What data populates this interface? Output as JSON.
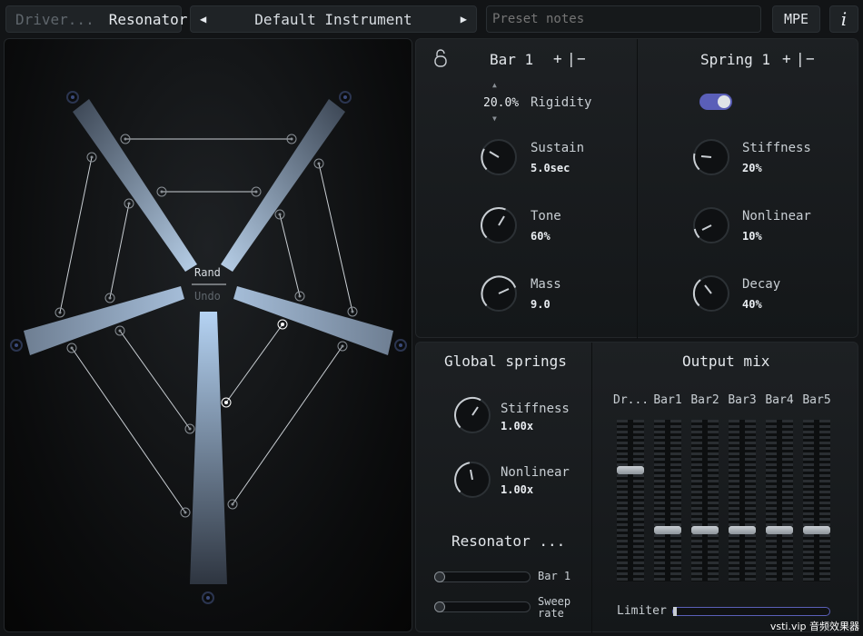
{
  "topbar": {
    "tab_driver": "Driver...",
    "tab_resonator": "Resonator",
    "instrument_name": "Default Instrument",
    "prev_arrow": "◀",
    "next_arrow": "▶",
    "notes_placeholder": "Preset notes",
    "mpe_label": "MPE",
    "info_label": "i"
  },
  "canvas": {
    "rand_label": "Rand",
    "undo_label": "Undo"
  },
  "bar_section": {
    "title": "Bar 1",
    "plus": "+",
    "sep": "|",
    "minus": "−",
    "rigidity_value": "20.0%",
    "rigidity_label": "Rigidity",
    "sustain_label": "Sustain",
    "sustain_value": "5.0sec",
    "tone_label": "Tone",
    "tone_value": "60%",
    "mass_label": "Mass",
    "mass_value": "9.0"
  },
  "spring_section": {
    "title": "Spring 1",
    "plus": "+",
    "sep": "|",
    "minus": "−",
    "toggle_on": true,
    "stiffness_label": "Stiffness",
    "stiffness_value": "20%",
    "nonlinear_label": "Nonlinear",
    "nonlinear_value": "10%",
    "decay_label": "Decay",
    "decay_value": "40%"
  },
  "global_springs": {
    "title": "Global springs",
    "stiffness_label": "Stiffness",
    "stiffness_value": "1.00x",
    "nonlinear_label": "Nonlinear",
    "nonlinear_value": "1.00x"
  },
  "resonator_sweep": {
    "title": "Resonator ...",
    "bar_label": "Bar 1",
    "sweep_label_line1": "Sweep",
    "sweep_label_line2": "rate"
  },
  "output_mix": {
    "title": "Output mix",
    "channels": [
      "Dr...",
      "Bar1",
      "Bar2",
      "Bar3",
      "Bar4",
      "Bar5"
    ],
    "limiter_label": "Limiter"
  },
  "watermark": "vsti.vip 音频效果器",
  "colors": {
    "accent": "#5a5fb8",
    "bar_light": "#a9c6e6",
    "bar_dark": "#2e3540"
  }
}
